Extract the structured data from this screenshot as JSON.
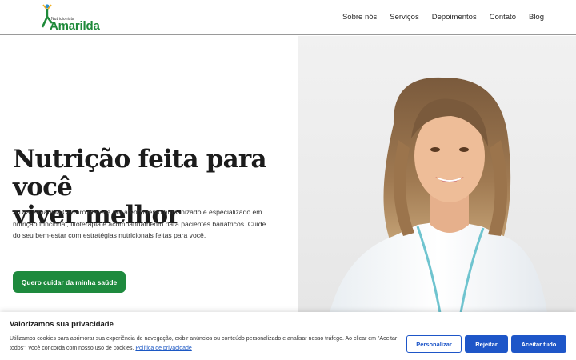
{
  "header": {
    "logo_small": "Nutricionista",
    "logo_big": "Amarilda",
    "nav": [
      "Sobre nós",
      "Serviços",
      "Depoimentos",
      "Contato",
      "Blog"
    ]
  },
  "hero": {
    "title_line1": "Nutrição feita para você",
    "title_line2": "viver melhor",
    "description": "A Dra. Amarilda Carraro oferece um atendimento humanizado e especializado em nutrição funcional, fitoterapia e acompanhamento para pacientes bariátricos. Cuide do seu bem-estar com estratégias nutricionais feitas para você.",
    "cta_label": "Quero cuidar da minha saúde"
  },
  "cookie": {
    "title": "Valorizamos sua privacidade",
    "text": "Utilizamos cookies para aprimorar sua experiência de navegação, exibir anúncios ou conteúdo personalizado e analisar nosso tráfego. Ao clicar em \"Aceitar todos\", você concorda com nosso uso de cookies.",
    "policy_link": "Política de privacidade",
    "personalize_label": "Personalizar",
    "reject_label": "Rejeitar",
    "accept_label": "Aceitar tudo"
  },
  "colors": {
    "brand_green": "#1e8a3e",
    "cookie_blue": "#1e56c8"
  }
}
